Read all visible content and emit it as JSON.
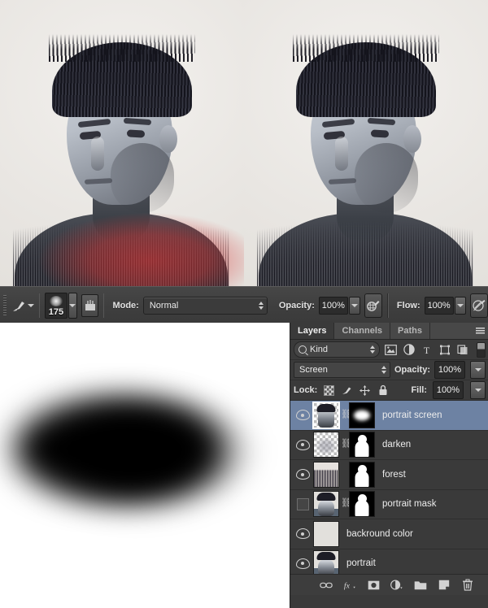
{
  "app": "Adobe Photoshop",
  "canvas": {
    "left_image": {
      "name": "portrait-with-red-quickmask",
      "description": "Double exposure portrait with forest texture and red quick mask overlay on shoulders"
    },
    "right_image": {
      "name": "portrait-final",
      "description": "Double exposure portrait with forest texture, no overlay"
    },
    "mask_preview": {
      "name": "layer-mask-preview",
      "description": "White canvas with soft black blurred ellipse"
    }
  },
  "options_bar": {
    "brush_preset_label": "brush-preset",
    "brush_size": "175",
    "mode_label": "Mode:",
    "mode_value": "Normal",
    "opacity_label": "Opacity:",
    "opacity_value": "100%",
    "airbrush_label": "airbrush",
    "flow_label": "Flow:",
    "flow_value": "100%",
    "tablet_pressure_label": "tablet-pressure"
  },
  "layers_panel": {
    "tabs": [
      {
        "label": "Layers",
        "active": true
      },
      {
        "label": "Channels",
        "active": false
      },
      {
        "label": "Paths",
        "active": false
      }
    ],
    "menu_label": "panel-menu",
    "filter": {
      "kind_value": "Kind",
      "icons": [
        "image-filter-icon",
        "adjustment-filter-icon",
        "type-filter-icon",
        "shape-filter-icon",
        "smart-object-filter-icon"
      ],
      "toggle_label": "filter-enable-toggle"
    },
    "blend_mode": "Screen",
    "opacity_label": "Opacity:",
    "opacity_value": "100%",
    "lock_label": "Lock:",
    "lock_icons": [
      "lock-transparent-pixels",
      "lock-image-pixels",
      "lock-position",
      "lock-all"
    ],
    "fill_label": "Fill:",
    "fill_value": "100%",
    "layers": [
      {
        "name": "portrait screen",
        "visible": true,
        "selected": true,
        "has_mask": true,
        "linked": true,
        "thumb": "transparent-portrait"
      },
      {
        "name": "darken",
        "visible": true,
        "selected": false,
        "has_mask": true,
        "linked": true,
        "thumb": "transparent-soft"
      },
      {
        "name": "forest",
        "visible": true,
        "selected": false,
        "has_mask": true,
        "linked": false,
        "thumb": "forest"
      },
      {
        "name": "portrait mask",
        "visible": false,
        "selected": false,
        "has_mask": true,
        "linked": true,
        "thumb": "portrait"
      },
      {
        "name": "backround color",
        "visible": true,
        "selected": false,
        "has_mask": false,
        "linked": false,
        "thumb": "solid-color"
      },
      {
        "name": "portrait",
        "visible": true,
        "selected": false,
        "has_mask": false,
        "linked": false,
        "thumb": "portrait"
      }
    ],
    "bottom_buttons": [
      {
        "name": "link-layers-button",
        "glyph": "⚭"
      },
      {
        "name": "layer-style-fx-button",
        "glyph": "fx"
      },
      {
        "name": "add-layer-mask-button",
        "glyph": ""
      },
      {
        "name": "new-adjustment-layer-button",
        "glyph": ""
      },
      {
        "name": "new-group-button",
        "glyph": ""
      },
      {
        "name": "new-layer-button",
        "glyph": ""
      },
      {
        "name": "delete-layer-button",
        "glyph": ""
      }
    ]
  },
  "colors": {
    "panel_bg": "#3a3a3a",
    "selection_blue": "#6d82a3",
    "options_bar": "#3f3f3f",
    "text": "#ececec",
    "quickmask_red": "#d63434"
  }
}
